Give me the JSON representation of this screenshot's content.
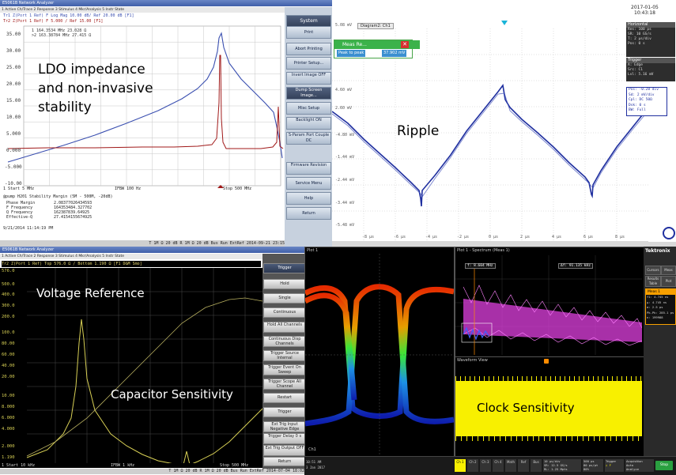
{
  "overlays": {
    "ldo": [
      "LDO impedance",
      "and non-invasive",
      "stability"
    ],
    "ripple": "Ripple",
    "voltage_reference": "Voltage Reference",
    "capacitor_sensitivity": "Capacitor Sensitivity",
    "clock_sensitivity": "Clock Sensitivity"
  },
  "na1": {
    "title": "E5061B Network Analyzer",
    "menu": "1 Active Ch/Trace   2 Response   3 Stimulus   4 Mkr/Analysis   5 Instr State",
    "trace1": "Tr1 Z(Port 1 Ref) F Log Mag 10.00 dB/ Ref 20.00 dB [F1]",
    "trace2": "Tr2 Z(Port 1 Ref) F 5.000 / Ref 15.00 [F1]",
    "mkr1": "1   164.3534 MHz   23.028 Ω",
    "mkr2": ">2   163.38784 MHz   27.415 Ω",
    "y_ticks": [
      "35.00",
      "30.00",
      "25.00",
      "20.00",
      "15.00",
      "10.00",
      "5.000",
      "0.000",
      "-5.000",
      "-10.00"
    ],
    "start": "1 Start 5 MHz",
    "ifbw": "IFBW 100 Hz",
    "stop": "Stop 500 MHz",
    "results_title": "@pump H201 Stability Margin (5M - 500M, -20dB)",
    "results": [
      [
        "Phase Margin",
        "2.08377026434593"
      ],
      [
        "F Frequency",
        "164353484.327702"
      ],
      [
        "Q Frequency",
        "162387839.64925"
      ],
      [
        "Effective-Q",
        "27.4154155674925"
      ]
    ],
    "timestamp": "9/21/2014 11:14:19 PM",
    "status": "T 1M Ω 20 dB  R 1M Ω 20 dB  Bus   Run  ExtRef  2014-09-21 23:15",
    "menu_buttons": [
      "System",
      "Print",
      "Abort Printing",
      "Printer Setup...",
      "Invert Image OFF",
      "Dump Screen Image...",
      "Misc Setup",
      "Backlight ON",
      "S-Param Port Couple DC",
      "Firmware Revision",
      "Service Menu",
      "Help",
      "Return"
    ]
  },
  "osc1": {
    "date": "2017-01-05",
    "time": "10:43:18",
    "diagram": "Diagram2: Ch1",
    "meas_title": "Meas Re...",
    "meas_label": "Peak to peak",
    "meas_value": "37.902 mV",
    "y_ticks": [
      "5.08 mV",
      "4.60 mV",
      "2.60 mV",
      "-4.80 mV",
      "-1.44 mV",
      "-2.44 mV",
      "-3.44 mV",
      "-5.48 mV"
    ],
    "x_ticks": [
      "-8 µs",
      "-6 µs",
      "-4 µs",
      "-2 µs",
      "0 µs",
      "2 µs",
      "4 µs",
      "6 µs",
      "8 µs"
    ],
    "horizontal_title": "Horizontal",
    "horizontal_lines": [
      "Res: 100 ps",
      "SR: 10 GS/s",
      "T: 2 µs/div",
      "Pos: 0 s"
    ],
    "trigger_title": "Trigger",
    "trigger_lines": [
      "A: Edge",
      "Src: C1",
      "Lvl: 5.16 mV"
    ],
    "ch1_lines": [
      "Pos: -0.28 div",
      "Sd: 2 mV/div",
      "Cpl: DC 50Ω",
      "Dsk: 0 s",
      "BW: Full"
    ]
  },
  "na2": {
    "title": "E5061B Network Analyzer",
    "menu": "1 Active Ch/Trace   2 Response   3 Stimulus   4 Mkr/Analysis   5 Instr State",
    "trace": "Tr2 Z(Port 1 Ref) Top 576.0 Ω / Bottom 1.190 Ω [F1 D&M Smo]",
    "y_ticks": [
      "576.0",
      "500.0",
      "400.0",
      "300.0",
      "200.0",
      "100.0",
      "80.00",
      "60.00",
      "40.00",
      "20.00",
      "10.00",
      "8.000",
      "6.000",
      "4.000",
      "2.000",
      "1.190"
    ],
    "start": "1 Start 10 kHz",
    "ifbw": "IFBW 1 kHz",
    "stop": "Stop 500 MHz",
    "status": "T 1M Ω 20 dB  R 1M Ω 20 dB  Bus   Run  ExtRef  2014-07-04 18:02",
    "side_title": "Trigger",
    "side_buttons": [
      "Hold",
      "Single",
      "Continuous",
      "Hold All Channels",
      "Continuous Disp Channels",
      "Trigger Source Internal",
      "Trigger Event On Sweep",
      "Trigger Scope All Channel",
      "Restart",
      "Trigger",
      "Ext Trig Input Negative Edge",
      "Trigger Delay 0 s",
      "Ext Trig Output OFF",
      "Return"
    ]
  },
  "tek": {
    "tab_eye": "Plot 1",
    "tab_spectrum": "Plot 1 - Spectrum (Meas 1)",
    "tab_waveform": "Waveform View",
    "brand": "Tektronix",
    "side_buttons": [
      "Cursors",
      "Meas",
      "Results Table",
      "Plot"
    ],
    "meas_title": "Meas 1",
    "meas_lines": [
      "f1: 4.745 ns",
      "µ: 4.745 ns",
      "σ: 2.5 ps",
      "Pk-Pk: 285.1 ps",
      "n: 199988"
    ],
    "spec_marker": "f: 8.604 MHz",
    "spec_marker2": "Δf: 91.135 kHz",
    "bottom_labels": [
      "Ch 1",
      "Ch 2",
      "Ch 3",
      "Ch 4",
      "Math",
      "Ref",
      "Bus",
      "Trigger",
      "Acquisition"
    ],
    "horiz_lines": [
      "10 µs/div",
      "SR: 12.5 GS/s",
      "RL: 1.25 Mpts"
    ],
    "scale_lines": [
      "500 ps",
      "80 ps/pt",
      "80%"
    ],
    "trigger_lines": [
      "⊥ F",
      ""
    ],
    "acq_lines": [
      "Auto",
      "Analyze",
      "Single"
    ],
    "ch_label": "Ch1",
    "time": "10:51 AM",
    "date": "3 Jan 2017",
    "run_button": "Stop"
  },
  "colors": {
    "na_bg": "#ffffff",
    "na_grid": "#bdbdbd",
    "na_blue": "#3a4fb0",
    "na_red": "#a01818",
    "na2_bg": "#000000",
    "na2_trace": "#d8d055",
    "osc_blue": "#1f2f9f",
    "tek_bg": "#000000",
    "tek_yellow": "#f8f000",
    "tek_magenta": "#e040e0",
    "tek_orange": "#ff8c00"
  }
}
